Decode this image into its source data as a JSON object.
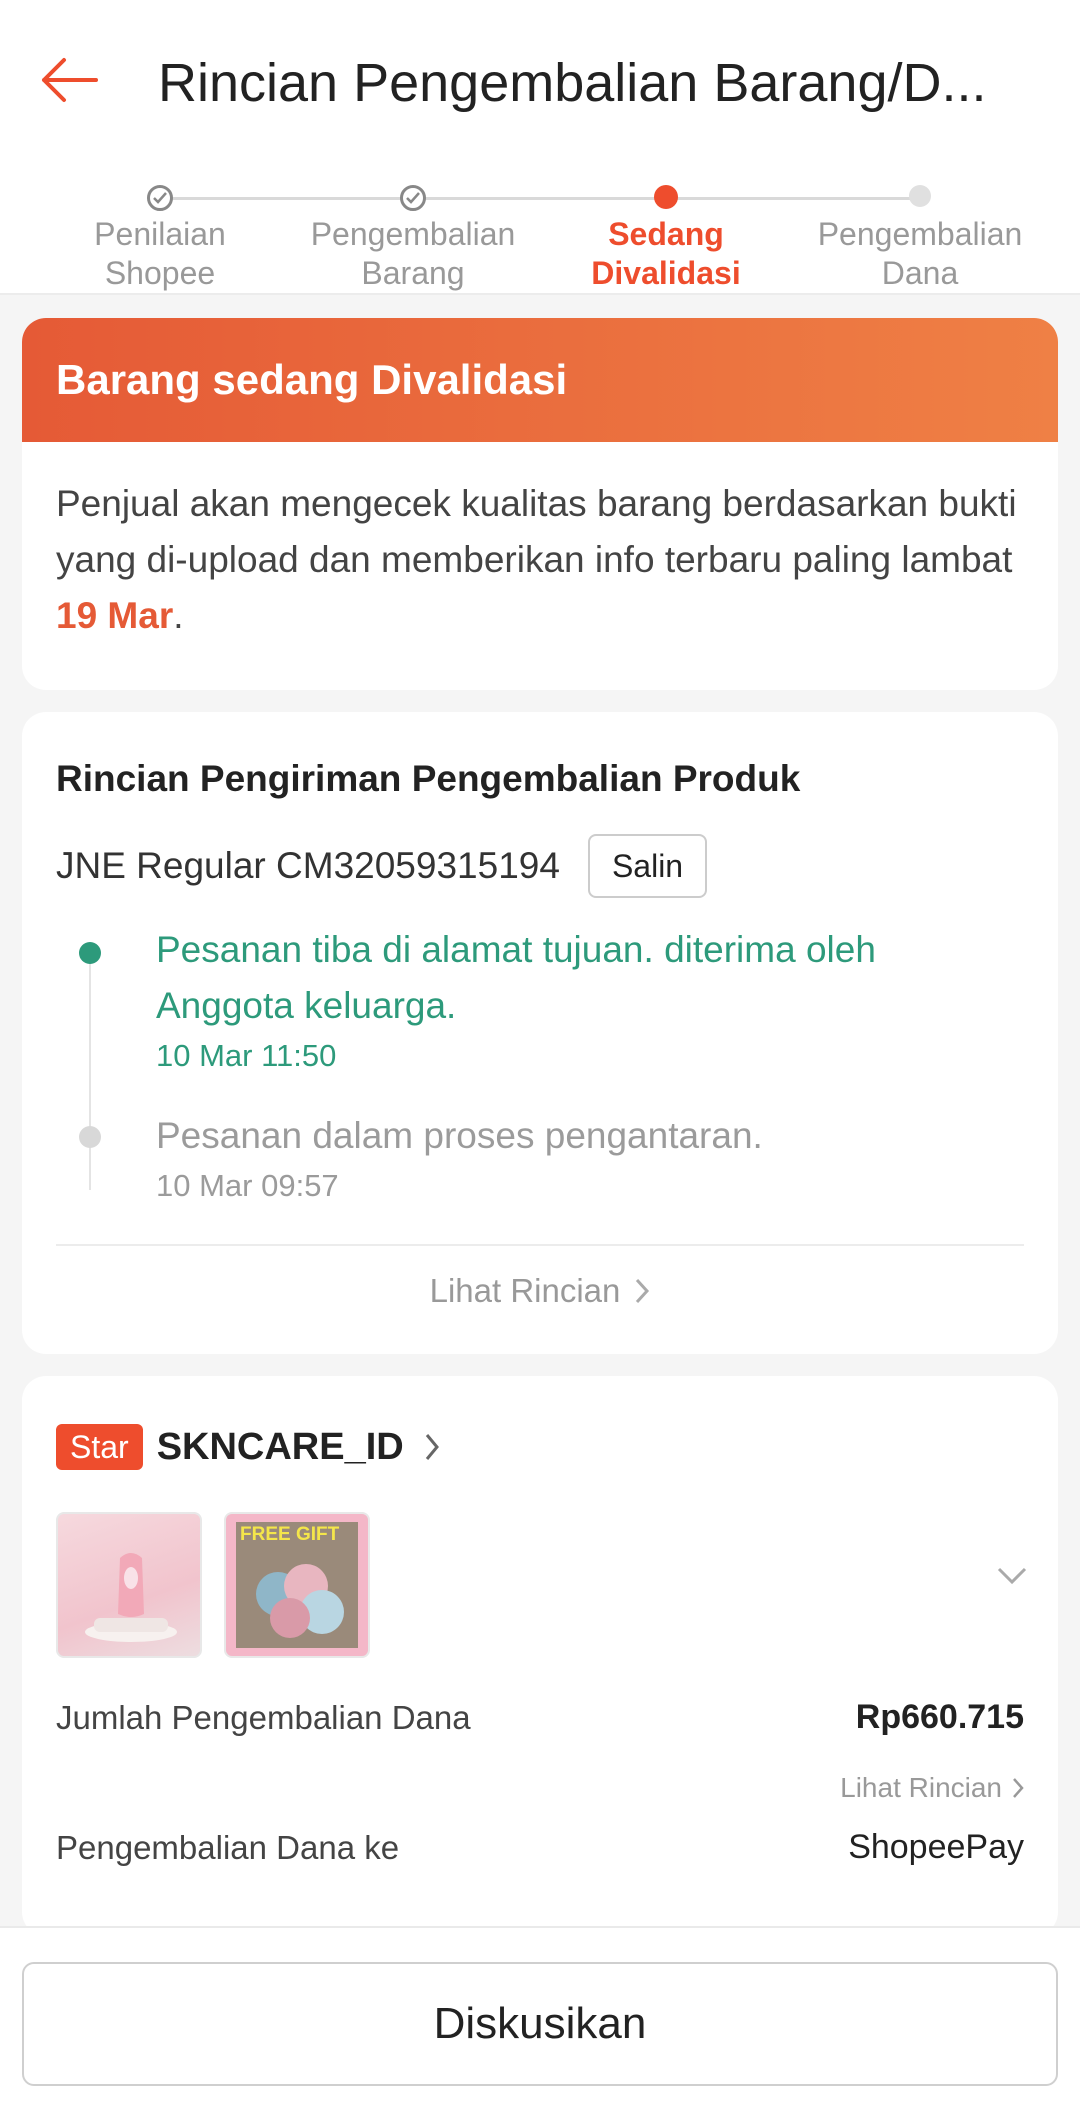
{
  "header": {
    "title": "Rincian Pengembalian Barang/D...",
    "back_icon": "arrow-left-icon",
    "accent_color": "#ee4d2d"
  },
  "stepper": {
    "steps": [
      {
        "line1": "Penilaian",
        "line2": "Shopee",
        "state": "done"
      },
      {
        "line1": "Pengembalian",
        "line2": "Barang",
        "state": "done"
      },
      {
        "line1": "Sedang",
        "line2": "Divalidasi",
        "state": "active"
      },
      {
        "line1": "Pengembalian",
        "line2": "Dana",
        "state": "todo"
      }
    ]
  },
  "status": {
    "banner_title": "Barang sedang Divalidasi",
    "body_prefix": "Penjual akan mengecek kualitas barang berdasarkan bukti yang di-upload dan memberikan info terbaru paling lambat ",
    "deadline": "19 Mar",
    "body_suffix": "."
  },
  "shipping": {
    "title": "Rincian Pengiriman Pengembalian Produk",
    "courier_tracking": "JNE Regular CM32059315194",
    "copy_label": "Salin",
    "events": [
      {
        "text": "Pesanan tiba di alamat tujuan. diterima oleh Anggota keluarga.",
        "time": "10 Mar 11:50"
      },
      {
        "text": "Pesanan dalam proses pengantaran.",
        "time": "10 Mar 09:57"
      }
    ],
    "see_detail": "Lihat Rincian"
  },
  "product": {
    "badge": "Star",
    "shop_name": "SKNCARE_ID",
    "thumb2_caption": "FREE GIFT",
    "refund_amount_label": "Jumlah Pengembalian Dana",
    "refund_amount": "Rp660.715",
    "refund_detail_link": "Lihat Rincian",
    "refund_to_label": "Pengembalian Dana ke",
    "refund_to": "ShopeePay"
  },
  "footer": {
    "discuss_label": "Diskusikan"
  }
}
